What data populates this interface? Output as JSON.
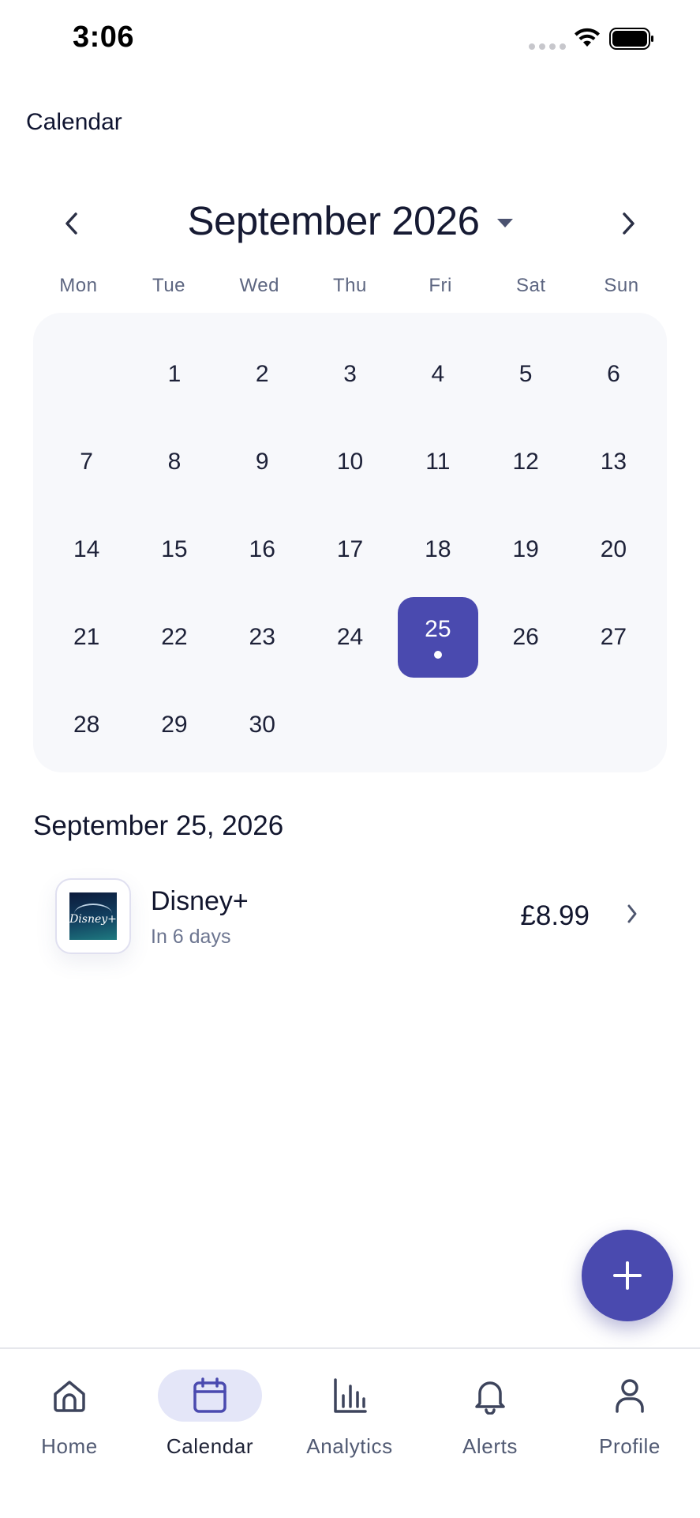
{
  "status_bar": {
    "time": "3:06"
  },
  "app": {
    "title": "Calendar"
  },
  "calendar": {
    "month_label": "September 2026",
    "weekdays": [
      "Mon",
      "Tue",
      "Wed",
      "Thu",
      "Fri",
      "Sat",
      "Sun"
    ],
    "weeks": [
      [
        "",
        "1",
        "2",
        "3",
        "4",
        "5",
        "6"
      ],
      [
        "7",
        "8",
        "9",
        "10",
        "11",
        "12",
        "13"
      ],
      [
        "14",
        "15",
        "16",
        "17",
        "18",
        "19",
        "20"
      ],
      [
        "21",
        "22",
        "23",
        "24",
        "25",
        "26",
        "27"
      ],
      [
        "28",
        "29",
        "30",
        "",
        "",
        "",
        ""
      ]
    ],
    "selected_day": "25",
    "accent_color": "#4a4aaf"
  },
  "selected_date": {
    "heading": "September 25, 2026",
    "subscriptions": [
      {
        "name": "Disney+",
        "due": "In 6 days",
        "price": "£8.99",
        "logo_text": "Disney+"
      }
    ]
  },
  "fab": {
    "icon": "plus-icon"
  },
  "tabbar": {
    "tabs": [
      {
        "label": "Home",
        "icon": "home-icon"
      },
      {
        "label": "Calendar",
        "icon": "calendar-icon",
        "active": true
      },
      {
        "label": "Analytics",
        "icon": "bar-chart-icon"
      },
      {
        "label": "Alerts",
        "icon": "bell-icon"
      },
      {
        "label": "Profile",
        "icon": "person-icon"
      }
    ]
  }
}
